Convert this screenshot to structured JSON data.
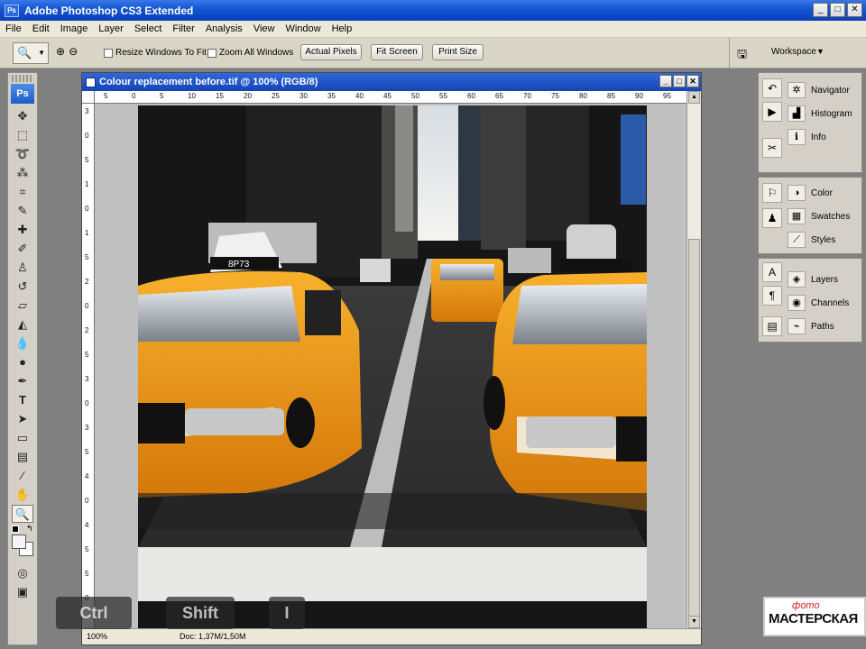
{
  "app": {
    "title": "Adobe Photoshop CS3 Extended",
    "logo_text": "Ps",
    "window_buttons": [
      "_",
      "□",
      "✕"
    ]
  },
  "menu": [
    "File",
    "Edit",
    "Image",
    "Layer",
    "Select",
    "Filter",
    "Analysis",
    "View",
    "Window",
    "Help"
  ],
  "options": {
    "resize_windows": "Resize Windows To Fit",
    "zoom_all": "Zoom All Windows",
    "actual_pixels": "Actual Pixels",
    "fit_screen": "Fit Screen",
    "print_size": "Print Size",
    "workspace": "Workspace"
  },
  "document": {
    "title": "Colour replacement before.tif @ 100% (RGB/8)",
    "zoom": "100%",
    "doc_size": "Doc: 1,37M/1,50M",
    "ruler_h": [
      "5",
      "0",
      "5",
      "10",
      "15",
      "20",
      "25",
      "30",
      "35",
      "40",
      "45",
      "50",
      "55",
      "60",
      "65",
      "70",
      "75",
      "80",
      "85",
      "90",
      "95"
    ],
    "ruler_v": [
      "3",
      "0",
      "5",
      "1",
      "0",
      "1",
      "5",
      "2",
      "0",
      "2",
      "5",
      "3",
      "0",
      "3",
      "5",
      "4",
      "0",
      "4",
      "5",
      "5",
      "0"
    ]
  },
  "panels": {
    "group1": [
      "Navigator",
      "Histogram",
      "Info"
    ],
    "group2": [
      "Color",
      "Swatches",
      "Styles"
    ],
    "group3": [
      "Layers",
      "Channels",
      "Paths"
    ]
  },
  "taxi_roof_text": "8P73",
  "keys": [
    "Ctrl",
    "Shift",
    "I"
  ],
  "logo": {
    "top": "фото",
    "main": "МАСТЕРСКАЯ"
  },
  "colors": {
    "title_bar": "#1557d4",
    "taxi_yellow": "#f59a0c",
    "panel_bg": "#d4d0c8"
  }
}
